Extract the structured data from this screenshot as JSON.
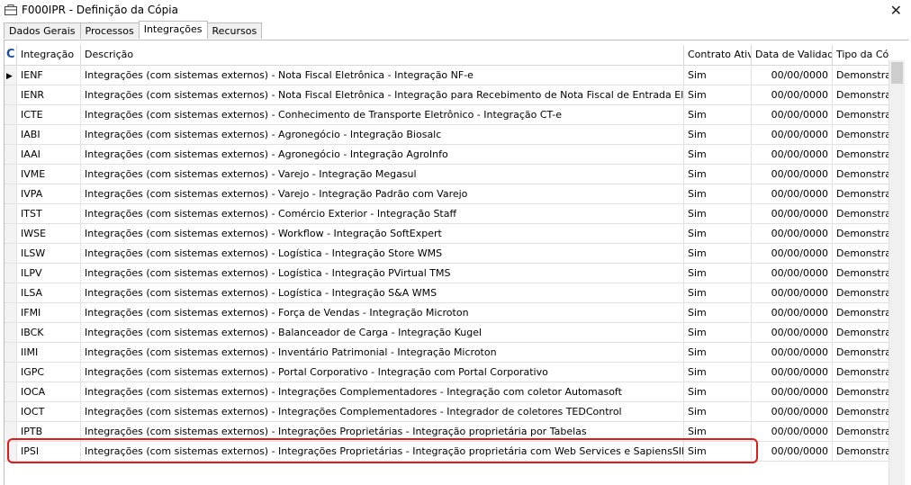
{
  "window": {
    "title": "F000IPR - Definição da Cópia",
    "close_glyph": "✕",
    "icon": "window-icon"
  },
  "tabs": [
    {
      "label": "Dados Gerais"
    },
    {
      "label": "Processos"
    },
    {
      "label": "Integrações",
      "active": true
    },
    {
      "label": "Recursos"
    }
  ],
  "grid": {
    "indicator_header": "C",
    "columns": [
      "Integração",
      "Descrição",
      "Contrato Ativo",
      "Data de Validade",
      "Tipo da Cópia"
    ],
    "rows": [
      [
        "IENF",
        "Integrações (com sistemas externos) - Nota Fiscal Eletrônica - Integração NF-e",
        "Sim",
        "00/00/0000",
        "Demonstração"
      ],
      [
        "IENR",
        "Integrações (com sistemas externos) - Nota Fiscal Eletrônica - Integração para Recebimento de Nota Fiscal de Entrada Eletrônica",
        "Sim",
        "00/00/0000",
        "Demonstração"
      ],
      [
        "ICTE",
        "Integrações (com sistemas externos) - Conhecimento de Transporte Eletrônico - Integração CT-e",
        "Sim",
        "00/00/0000",
        "Demonstração"
      ],
      [
        "IABI",
        "Integrações (com sistemas externos) - Agronegócio - Integração Biosalc",
        "Sim",
        "00/00/0000",
        "Demonstração"
      ],
      [
        "IAAI",
        "Integrações (com sistemas externos) - Agronegócio - Integração AgroInfo",
        "Sim",
        "00/00/0000",
        "Demonstração"
      ],
      [
        "IVME",
        "Integrações (com sistemas externos) - Varejo - Integração Megasul",
        "Sim",
        "00/00/0000",
        "Demonstração"
      ],
      [
        "IVPA",
        "Integrações (com sistemas externos) - Varejo - Integração Padrão com Varejo",
        "Sim",
        "00/00/0000",
        "Demonstração"
      ],
      [
        "ITST",
        "Integrações (com sistemas externos) - Comércio Exterior - Integração Staff",
        "Sim",
        "00/00/0000",
        "Demonstração"
      ],
      [
        "IWSE",
        "Integrações (com sistemas externos) - Workflow - Integração SoftExpert",
        "Sim",
        "00/00/0000",
        "Demonstração"
      ],
      [
        "ILSW",
        "Integrações (com sistemas externos) - Logística - Integração Store WMS",
        "Sim",
        "00/00/0000",
        "Demonstração"
      ],
      [
        "ILPV",
        "Integrações (com sistemas externos) - Logística - Integração PVirtual TMS",
        "Sim",
        "00/00/0000",
        "Demonstração"
      ],
      [
        "ILSA",
        "Integrações (com sistemas externos) - Logística - Integração S&A WMS",
        "Sim",
        "00/00/0000",
        "Demonstração"
      ],
      [
        "IFMI",
        "Integrações (com sistemas externos) - Força de Vendas - Integração Microton",
        "Sim",
        "00/00/0000",
        "Demonstração"
      ],
      [
        "IBCK",
        "Integrações (com sistemas externos) - Balanceador de Carga - Integração Kugel",
        "Sim",
        "00/00/0000",
        "Demonstração"
      ],
      [
        "IIMI",
        "Integrações (com sistemas externos) - Inventário Patrimonial - Integração Microton",
        "Sim",
        "00/00/0000",
        "Demonstração"
      ],
      [
        "IGPC",
        "Integrações (com sistemas externos) - Portal Corporativo - Integração com Portal Corporativo",
        "Sim",
        "00/00/0000",
        "Demonstração"
      ],
      [
        "IOCA",
        "Integrações (com sistemas externos) - Integrações Complementadores - Integração com coletor Automasoft",
        "Sim",
        "00/00/0000",
        "Demonstração"
      ],
      [
        "IOCT",
        "Integrações (com sistemas externos) - Integrações Complementadores - Integrador de coletores TEDControl",
        "Sim",
        "00/00/0000",
        "Demonstração"
      ],
      [
        "IPTB",
        "Integrações (com sistemas externos) - Integrações Proprietárias - Integração proprietária por Tabelas",
        "Sim",
        "00/00/0000",
        "Demonstração"
      ],
      [
        "IPSI",
        "Integrações (com sistemas externos) - Integrações Proprietárias - Integração proprietária com Web Services e SapiensSID",
        "Sim",
        "00/00/0000",
        "Demonstração"
      ]
    ],
    "current_row_pointer": "▶",
    "highlighted_row_index": 19,
    "highlight_color": "#e01b1b"
  }
}
